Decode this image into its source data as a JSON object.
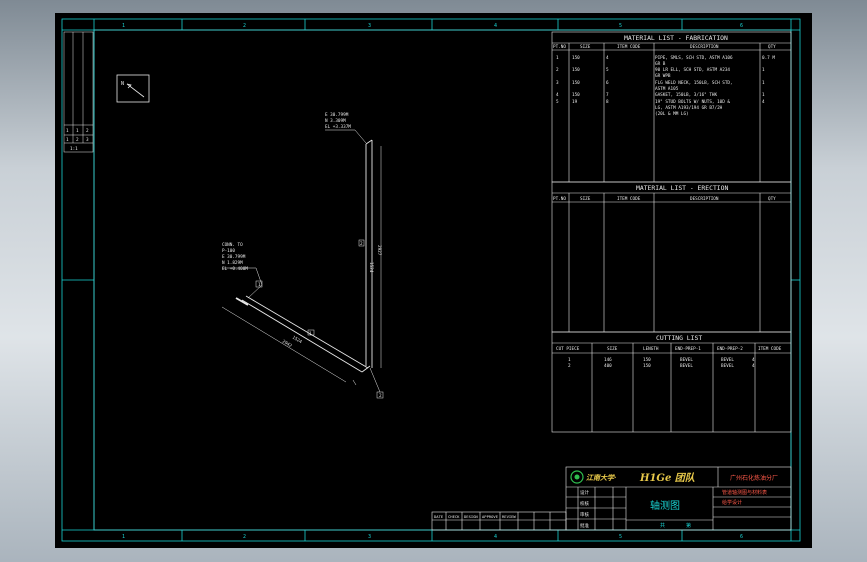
{
  "colors": {
    "viewport": "#000000",
    "frame": "#19d4d4",
    "lines": "#e8e8e8",
    "logo_text": "#e8c94a",
    "red_text": "#ff5a4a",
    "desktop": "#c9d0d6"
  },
  "border": {
    "top_zones": [
      "1",
      "2",
      "3",
      "4",
      "5",
      "6"
    ],
    "bottom_zones": [
      "1",
      "2",
      "3",
      "4",
      "5",
      "6"
    ]
  },
  "left_block": {
    "row_a": [
      "1",
      "1",
      "2"
    ],
    "row_b": [
      "1",
      "2",
      "3"
    ],
    "footer": "1:1"
  },
  "north_arrow": {
    "label": "N"
  },
  "iso": {
    "top_coords": [
      "E 30.799M",
      "N 3.309M",
      "EL +3.337M"
    ],
    "conn_coords": [
      "CONN. TO",
      "P-100",
      "E 30.799M",
      "N 1.829M",
      "EL +0.400M"
    ],
    "bubble1": "2",
    "bubble2": "1",
    "pipe_dims": {
      "vertical": "1524",
      "vertical_total": "2927",
      "diag": "1524",
      "diag_total": "2942"
    },
    "end_marks": [
      "1",
      "2"
    ]
  },
  "fab": {
    "title": "MATERIAL LIST - FABRICATION",
    "headers": [
      "PT.NO",
      "SIZE",
      "ITEM CODE",
      "DESCRIPTION",
      "QTY"
    ],
    "rows": [
      {
        "no": "1",
        "size": "150",
        "code": "4",
        "desc": [
          "PIPE, SMLS, SCH STD, ASTM A106",
          "GR B"
        ],
        "qty": "0.7 M"
      },
      {
        "no": "2",
        "size": "150",
        "code": "5",
        "desc": [
          "90 LR ELL, SCH STD, ASTM A234",
          "GR WPB"
        ],
        "qty": "1"
      },
      {
        "no": "3",
        "size": "150",
        "code": "6",
        "desc": [
          "FLG WELD NECK, 150LB, SCH STD,",
          "ASTM A105"
        ],
        "qty": "1"
      },
      {
        "no": "4",
        "size": "150",
        "code": "7",
        "desc": [
          "GASKET, 150LB, 3/16\" THK"
        ],
        "qty": "1"
      },
      {
        "no": "5",
        "size": "19",
        "code": "8",
        "desc": [
          "19\" STUD BOLTS W/ NUTS, 10D &",
          "LG, ASTM A193/194 GR B7/2H",
          "(20L & MM LG)"
        ],
        "qty": "4"
      }
    ]
  },
  "erec": {
    "title": "MATERIAL LIST - ERECTION",
    "headers": [
      "PT.NO",
      "SIZE",
      "ITEM CODE",
      "DESCRIPTION",
      "QTY"
    ]
  },
  "cut": {
    "title": "CUTTING LIST",
    "headers": [
      "CUT PIECE",
      "SIZE",
      "LENGTH",
      "END-PREP-1",
      "END-PREP-2",
      "ITEM CODE"
    ],
    "rows": [
      {
        "piece": "1",
        "size": "146",
        "length": "150",
        "ep1": "BEVEL",
        "ep2": "BEVEL",
        "code": "4"
      },
      {
        "piece": "2",
        "size": "400",
        "length": "150",
        "ep1": "BEVEL",
        "ep2": "BEVEL",
        "code": "4"
      }
    ]
  },
  "title_block": {
    "logo_text": "H1Ge 团队",
    "school_glyphs": "江南大学·",
    "company": "广州石化炼油分厂",
    "project_lines": [
      "管道轴测图与材料表",
      "给学设计"
    ],
    "drawing_title": "轴测图",
    "sheet_labels": [
      "共",
      "第"
    ],
    "revision_headers": [
      "DATE",
      "CHECK",
      "DESIGN",
      "APPROVE",
      "REVIEW"
    ],
    "sign_rows": [
      "设计",
      "校核",
      "审核",
      "批准"
    ]
  }
}
